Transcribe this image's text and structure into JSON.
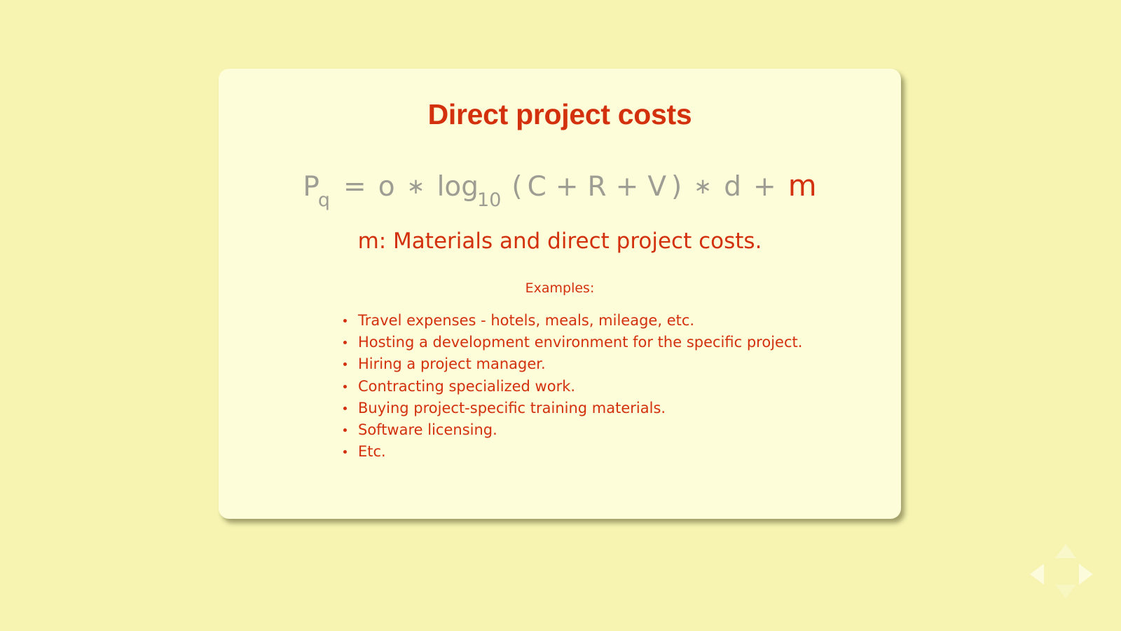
{
  "colors": {
    "page_background": "#F6F4B0",
    "card_background": "#FDFDD9",
    "accent_red": "#D3300D",
    "formula_gray": "#9D9D94"
  },
  "slide": {
    "title": "Direct project costs",
    "subtitle": "m: Materials and direct project costs.",
    "examples_label": "Examples:"
  },
  "formula": {
    "plain_text": "Pq = o * log10 ( C + R + V ) * d + m",
    "highlighted_variable": "m",
    "tokens": {
      "p": "P",
      "p_sub": "q",
      "equals": "=",
      "o": "o",
      "ast1": "∗",
      "log": "log",
      "log_sub": "10",
      "paren_open": "(",
      "c": "C",
      "plus1": "+",
      "r": "R",
      "plus2": "+",
      "v": "V",
      "paren_close": ")",
      "ast2": "∗",
      "d": "d",
      "plus3": "+",
      "m": "m"
    }
  },
  "examples": [
    "Travel expenses - hotels, meals, mileage, etc.",
    "Hosting a development environment for the specific project.",
    "Hiring a project manager.",
    "Contracting specialized work.",
    "Buying project-specific training materials.",
    "Software licensing.",
    "Etc."
  ],
  "navigation": {
    "up_label": "▲",
    "down_label": "▼",
    "left_label": "◀",
    "right_label": "▶"
  }
}
